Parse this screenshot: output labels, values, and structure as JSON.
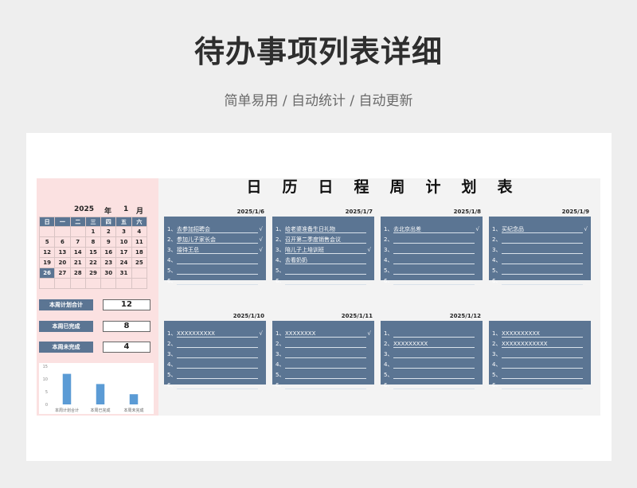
{
  "header": {
    "title": "待办事项列表详细",
    "subtitle": "简单易用 / 自动统计 / 自动更新"
  },
  "calendar": {
    "year": "2025",
    "year_unit": "年",
    "month": "1",
    "month_unit": "月",
    "weekdays": [
      "日",
      "一",
      "二",
      "三",
      "四",
      "五",
      "六"
    ],
    "weeks": [
      [
        "",
        "",
        "",
        "1",
        "2",
        "3",
        "4"
      ],
      [
        "5",
        "6",
        "7",
        "8",
        "9",
        "10",
        "11"
      ],
      [
        "12",
        "13",
        "14",
        "15",
        "16",
        "17",
        "18"
      ],
      [
        "19",
        "20",
        "21",
        "22",
        "23",
        "24",
        "25"
      ],
      [
        "26",
        "27",
        "28",
        "29",
        "30",
        "31",
        ""
      ],
      [
        "",
        "",
        "",
        "",
        "",
        "",
        ""
      ]
    ],
    "highlight_day": "26"
  },
  "stats": [
    {
      "label": "本周计划合计",
      "value": "12"
    },
    {
      "label": "本周已完成",
      "value": "8"
    },
    {
      "label": "本周未完成",
      "value": "4"
    }
  ],
  "chart_data": {
    "type": "bar",
    "categories": [
      "本周计划合计",
      "本周已完成",
      "本周未完成"
    ],
    "values": [
      12,
      8,
      4
    ],
    "ylim": [
      0,
      15
    ],
    "yticks": [
      "0",
      "5",
      "10",
      "15"
    ],
    "color": "#5b9bd5"
  },
  "plan": {
    "title": "日历日程周计划表",
    "days": [
      {
        "date": "2025/1/6",
        "tasks": [
          {
            "num": "1、",
            "text": "去参加招聘会",
            "done": "√"
          },
          {
            "num": "2、",
            "text": "参加儿子家长会",
            "done": "√"
          },
          {
            "num": "3、",
            "text": "接待王总",
            "done": "√"
          },
          {
            "num": "4、",
            "text": "",
            "done": ""
          },
          {
            "num": "5、",
            "text": "",
            "done": ""
          },
          {
            "num": "6、",
            "text": "",
            "done": ""
          }
        ]
      },
      {
        "date": "2025/1/7",
        "tasks": [
          {
            "num": "1、",
            "text": "给老婆准备生日礼物",
            "done": ""
          },
          {
            "num": "2、",
            "text": "召开第二季度销售会议",
            "done": ""
          },
          {
            "num": "3、",
            "text": "陪儿子上培训班",
            "done": "√"
          },
          {
            "num": "4、",
            "text": "去看奶奶",
            "done": ""
          },
          {
            "num": "5、",
            "text": "",
            "done": ""
          },
          {
            "num": "6、",
            "text": "",
            "done": ""
          }
        ]
      },
      {
        "date": "2025/1/8",
        "tasks": [
          {
            "num": "1、",
            "text": "去北京出差",
            "done": "√"
          },
          {
            "num": "2、",
            "text": "",
            "done": ""
          },
          {
            "num": "3、",
            "text": "",
            "done": ""
          },
          {
            "num": "4、",
            "text": "",
            "done": ""
          },
          {
            "num": "5、",
            "text": "",
            "done": ""
          },
          {
            "num": "6、",
            "text": "",
            "done": ""
          }
        ]
      },
      {
        "date": "2025/1/9",
        "tasks": [
          {
            "num": "1、",
            "text": "买纪念品",
            "done": "√"
          },
          {
            "num": "2、",
            "text": "",
            "done": ""
          },
          {
            "num": "3、",
            "text": "",
            "done": ""
          },
          {
            "num": "4、",
            "text": "",
            "done": ""
          },
          {
            "num": "5、",
            "text": "",
            "done": ""
          },
          {
            "num": "6、",
            "text": "",
            "done": ""
          }
        ]
      },
      {
        "date": "2025/1/10",
        "tasks": [
          {
            "num": "1、",
            "text": "XXXXXXXXXX",
            "done": "√"
          },
          {
            "num": "2、",
            "text": "",
            "done": ""
          },
          {
            "num": "3、",
            "text": "",
            "done": ""
          },
          {
            "num": "4、",
            "text": "",
            "done": ""
          },
          {
            "num": "5、",
            "text": "",
            "done": ""
          },
          {
            "num": "6、",
            "text": "",
            "done": ""
          }
        ]
      },
      {
        "date": "2025/1/11",
        "tasks": [
          {
            "num": "1、",
            "text": "XXXXXXXX",
            "done": "√"
          },
          {
            "num": "2、",
            "text": "",
            "done": ""
          },
          {
            "num": "3、",
            "text": "",
            "done": ""
          },
          {
            "num": "4、",
            "text": "",
            "done": ""
          },
          {
            "num": "5、",
            "text": "",
            "done": ""
          },
          {
            "num": "6、",
            "text": "",
            "done": ""
          }
        ]
      },
      {
        "date": "2025/1/12",
        "tasks": [
          {
            "num": "1、",
            "text": "",
            "done": ""
          },
          {
            "num": "2、",
            "text": "XXXXXXXXX",
            "done": ""
          },
          {
            "num": "3、",
            "text": "",
            "done": ""
          },
          {
            "num": "4、",
            "text": "",
            "done": ""
          },
          {
            "num": "5、",
            "text": "",
            "done": ""
          },
          {
            "num": "6、",
            "text": "",
            "done": ""
          }
        ]
      },
      {
        "date": "",
        "tasks": [
          {
            "num": "1、",
            "text": "XXXXXXXXXX",
            "done": ""
          },
          {
            "num": "2、",
            "text": "XXXXXXXXXXXX",
            "done": ""
          },
          {
            "num": "3、",
            "text": "",
            "done": ""
          },
          {
            "num": "4、",
            "text": "",
            "done": ""
          },
          {
            "num": "5、",
            "text": "",
            "done": ""
          },
          {
            "num": "6、",
            "text": "",
            "done": ""
          }
        ]
      }
    ]
  }
}
